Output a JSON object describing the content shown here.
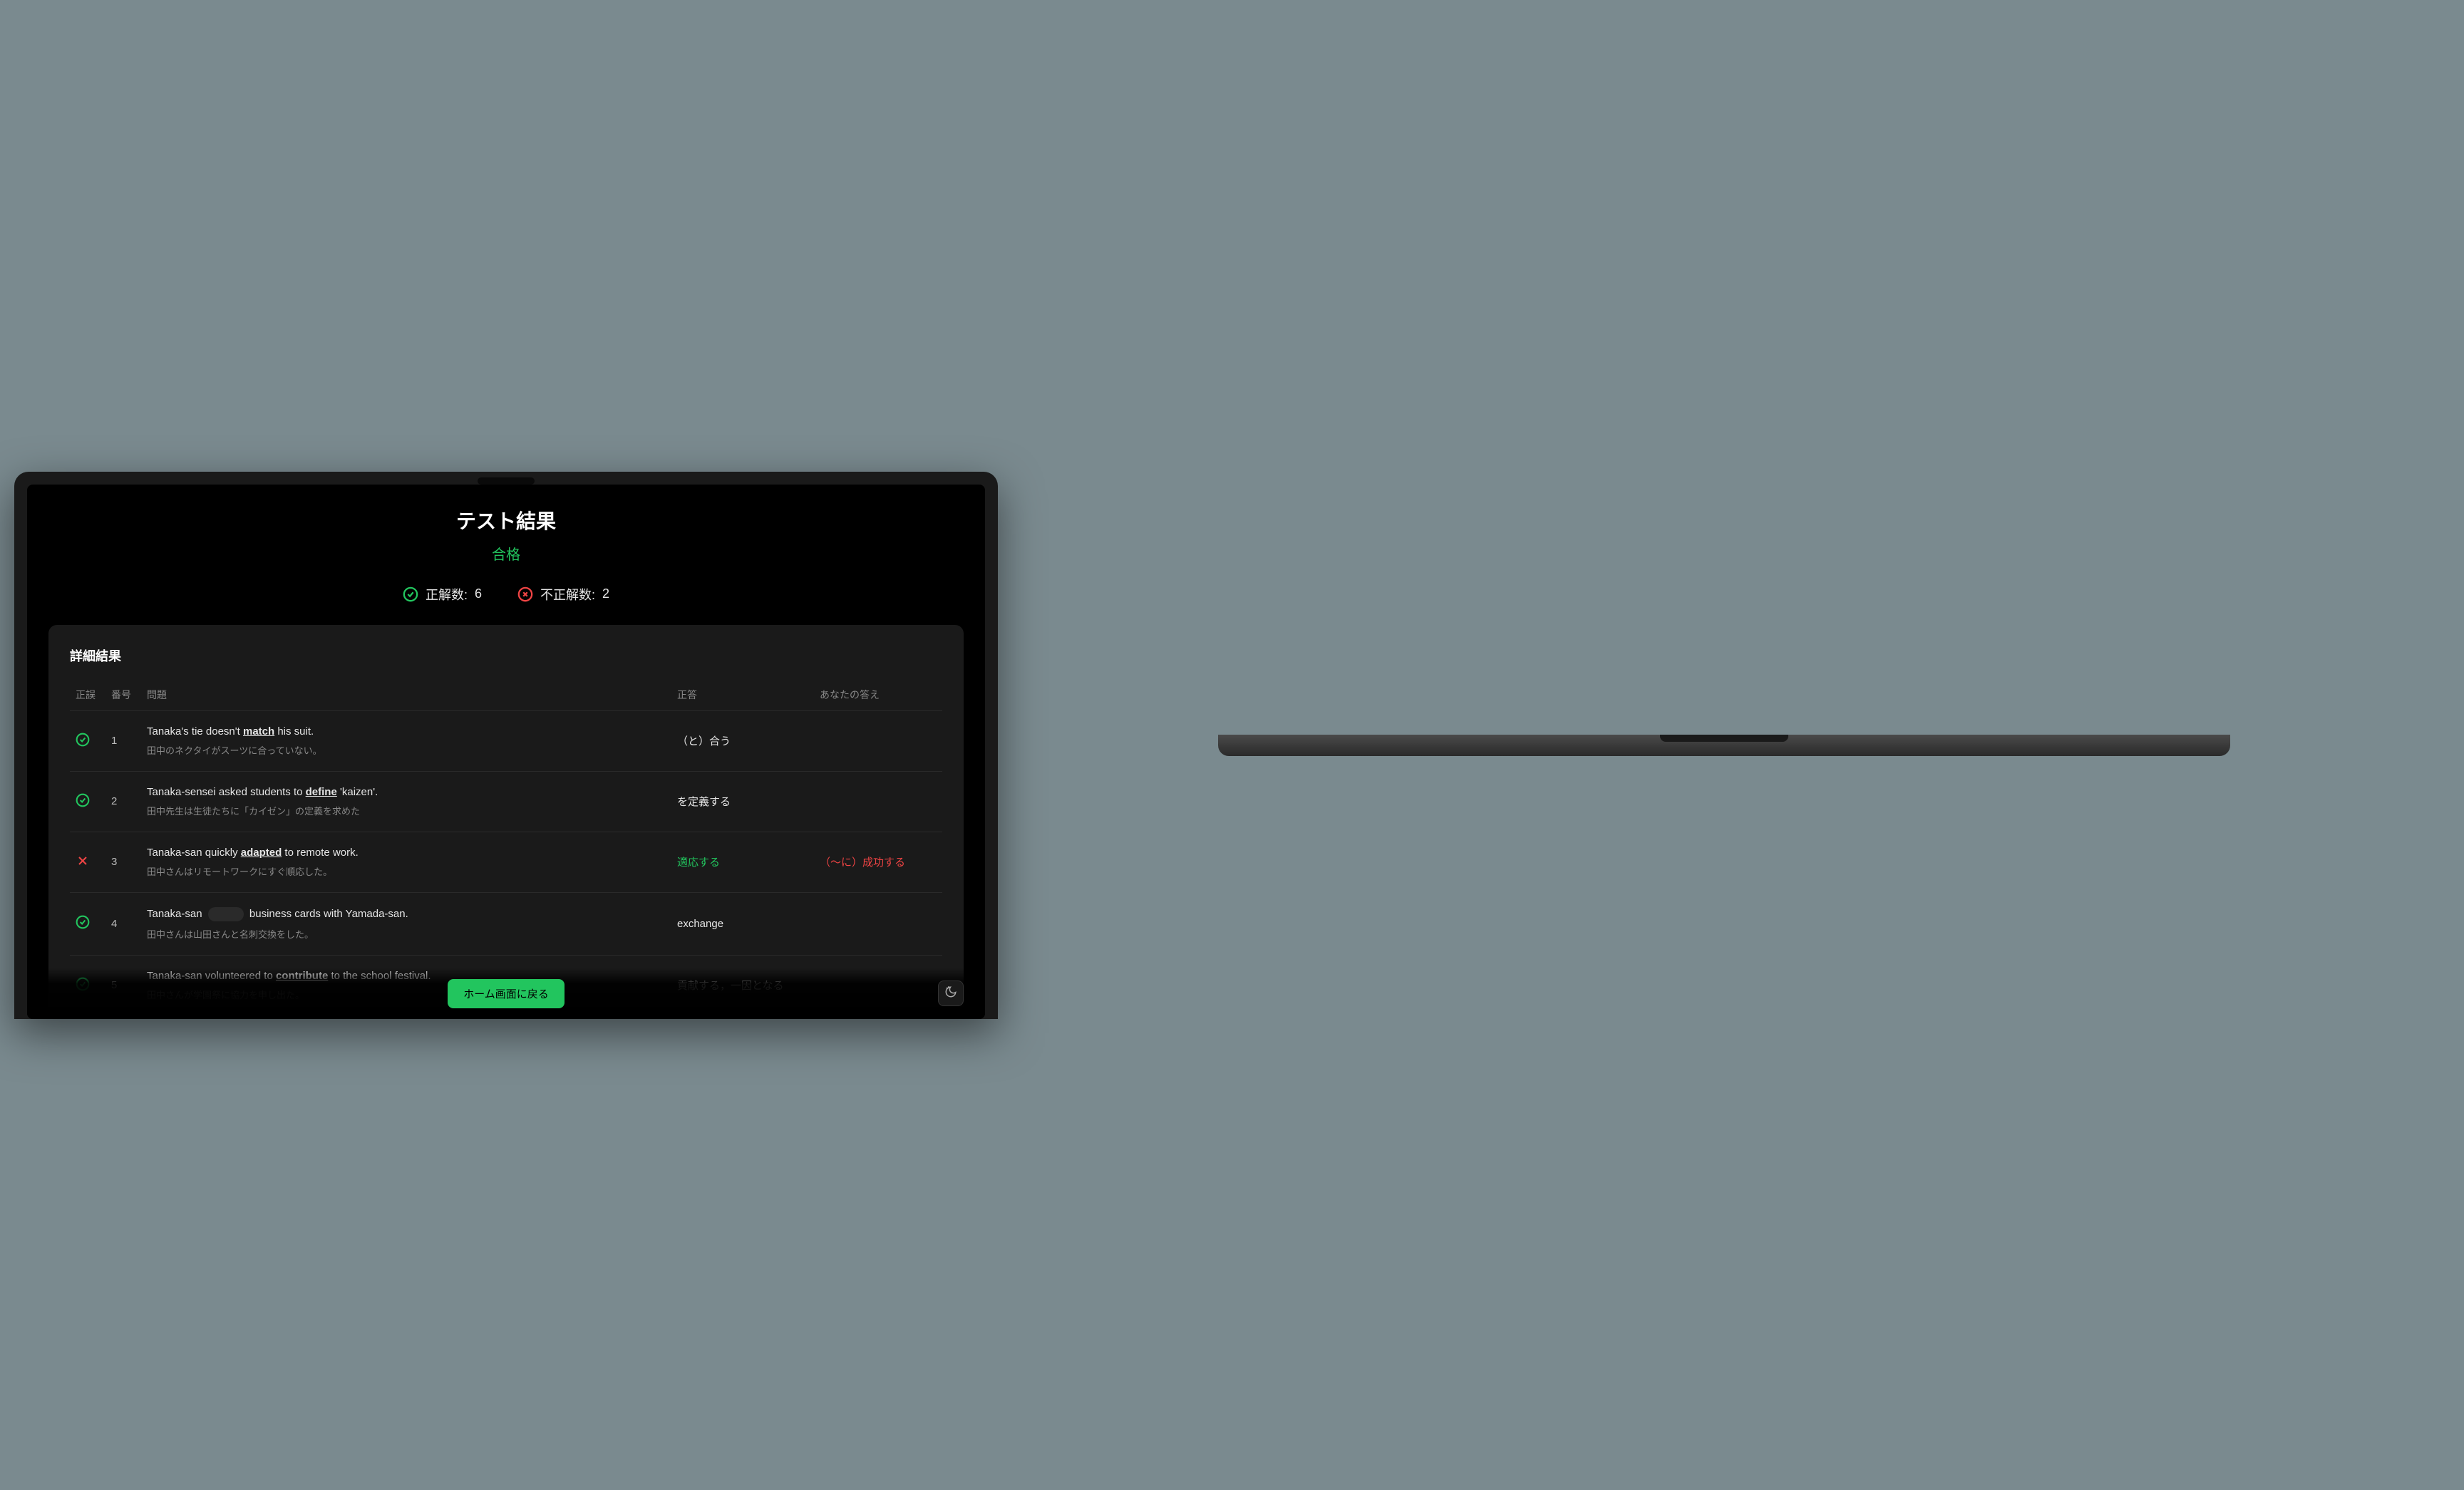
{
  "header": {
    "title": "テスト結果",
    "status": "合格"
  },
  "summary": {
    "correct_label": "正解数:",
    "correct_count": "6",
    "incorrect_label": "不正解数:",
    "incorrect_count": "2"
  },
  "card": {
    "title": "詳細結果",
    "columns": {
      "status": "正誤",
      "number": "番号",
      "question": "問題",
      "answer": "正答",
      "user_answer": "あなたの答え"
    }
  },
  "results": [
    {
      "correct": true,
      "number": "1",
      "sentence_before": "Tanaka's tie doesn't ",
      "keyword": "match",
      "sentence_after": " his suit.",
      "blank": false,
      "translation": "田中のネクタイがスーツに合っていない。",
      "answer": "（と）合う",
      "answer_highlight": false,
      "user_answer": ""
    },
    {
      "correct": true,
      "number": "2",
      "sentence_before": "Tanaka-sensei asked students to ",
      "keyword": "define",
      "sentence_after": " 'kaizen'.",
      "blank": false,
      "translation": "田中先生は生徒たちに「カイゼン」の定義を求めた",
      "answer": "を定義する",
      "answer_highlight": false,
      "user_answer": ""
    },
    {
      "correct": false,
      "number": "3",
      "sentence_before": "Tanaka-san quickly ",
      "keyword": "adapted",
      "sentence_after": " to remote work.",
      "blank": false,
      "translation": "田中さんはリモートワークにすぐ順応した。",
      "answer": "適応する",
      "answer_highlight": true,
      "user_answer": "（〜に）成功する"
    },
    {
      "correct": true,
      "number": "4",
      "sentence_before": "Tanaka-san ",
      "keyword": "",
      "sentence_after": " business cards with Yamada-san.",
      "blank": true,
      "translation": "田中さんは山田さんと名刺交換をした。",
      "answer": "exchange",
      "answer_highlight": false,
      "user_answer": ""
    },
    {
      "correct": true,
      "number": "5",
      "sentence_before": "Tanaka-san volunteered to ",
      "keyword": "contribute",
      "sentence_after": " to the school festival.",
      "blank": false,
      "translation": "田中さんが学園祭に協力を申し出た。",
      "answer": "貢献する，一因となる",
      "answer_highlight": false,
      "user_answer": ""
    }
  ],
  "footer": {
    "home_button": "ホーム画面に戻る"
  }
}
